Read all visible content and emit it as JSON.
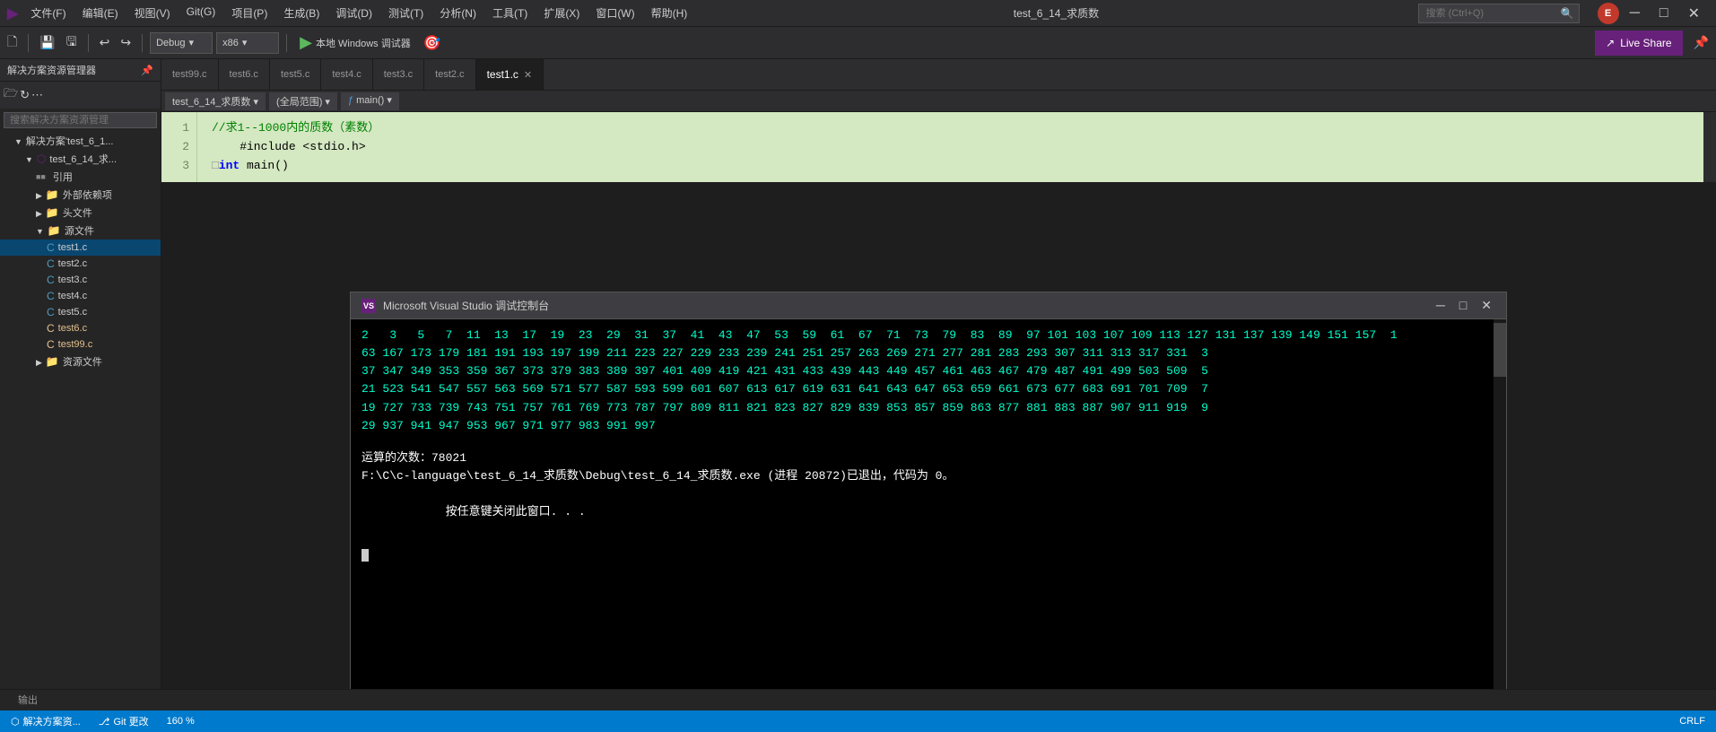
{
  "app": {
    "title": "test_6_14_求质数",
    "icon": "▶"
  },
  "menu": {
    "items": [
      "文件(F)",
      "编辑(E)",
      "视图(V)",
      "Git(G)",
      "项目(P)",
      "生成(B)",
      "调试(D)",
      "测试(T)",
      "分析(N)",
      "工具(T)",
      "扩展(X)",
      "窗口(W)",
      "帮助(H)"
    ]
  },
  "search": {
    "placeholder": "搜索 (Ctrl+Q)"
  },
  "toolbar": {
    "config_label": "Debug",
    "platform_label": "x86",
    "run_label": "本地 Windows 调试器",
    "liveshare_label": "Live Share"
  },
  "sidebar": {
    "header": "解决方案资源管理器",
    "search_placeholder": "搜索解决方案资源管理",
    "tree": [
      {
        "label": "解决方案'test_6_1...",
        "level": 1,
        "type": "solution",
        "expanded": true
      },
      {
        "label": "test_6_14_求...",
        "level": 2,
        "type": "project",
        "expanded": true
      },
      {
        "label": "引用",
        "level": 3,
        "type": "folder",
        "expanded": false
      },
      {
        "label": "外部依赖项",
        "level": 3,
        "type": "folder",
        "expanded": false
      },
      {
        "label": "头文件",
        "level": 3,
        "type": "folder",
        "expanded": false
      },
      {
        "label": "源文件",
        "level": 3,
        "type": "folder",
        "expanded": true
      },
      {
        "label": "test1.c",
        "level": 4,
        "type": "file-active"
      },
      {
        "label": "test2.c",
        "level": 4,
        "type": "file"
      },
      {
        "label": "test3.c",
        "level": 4,
        "type": "file"
      },
      {
        "label": "test4.c",
        "level": 4,
        "type": "file"
      },
      {
        "label": "test5.c",
        "level": 4,
        "type": "file"
      },
      {
        "label": "test6.c",
        "level": 4,
        "type": "file-modified"
      },
      {
        "label": "test99.c",
        "level": 4,
        "type": "file-modified"
      },
      {
        "label": "资源文件",
        "level": 3,
        "type": "folder",
        "expanded": false
      }
    ]
  },
  "tabs": [
    {
      "label": "test99.c",
      "active": false,
      "modified": false
    },
    {
      "label": "test6.c",
      "active": false,
      "modified": false
    },
    {
      "label": "test5.c",
      "active": false,
      "modified": false
    },
    {
      "label": "test4.c",
      "active": false,
      "modified": false
    },
    {
      "label": "test3.c",
      "active": false,
      "modified": false
    },
    {
      "label": "test2.c",
      "active": false,
      "modified": false
    },
    {
      "label": "test1.c",
      "active": true,
      "modified": false
    }
  ],
  "navbar": {
    "breadcrumb": "test_6_14_求质数",
    "scope": "(全局范围)",
    "function": "main()"
  },
  "code": {
    "lines": [
      {
        "num": "1",
        "content": "    //求1--1000内的质数（素数）"
      },
      {
        "num": "2",
        "content": "    #include <stdio.h>"
      },
      {
        "num": "3",
        "content": "  □int main()"
      }
    ]
  },
  "debug_console": {
    "title": "Microsoft Visual Studio 调试控制台",
    "output_lines": [
      "2   3   5   7  11  13  17  19  23  29  31  37  41  43  47  53  59  61  67  71  73  79  83  89  97 101 103 107 109 113 127 131 137 139 149 151 157  1",
      "63 167 173 179 181 191 193 197 199 211 223 227 229 233 239 241 251 257 263 269 271 277 281 283 293 307 311 313 317 331  3",
      "37 347 349 353 359 367 373 379 383 389 397 401 409 419 421 431 433 439 443 449 457 461 463 467 479 487 491 499 503 509  5",
      "21 523 541 547 557 563 569 571 577 587 593 599 601 607 613 617 619 631 641 643 647 653 659 661 673 677 683 691 701 709  7",
      "19 727 733 739 743 751 757 761 769 773 787 797 809 811 821 823 827 829 839 853 857 859 863 877 881 883 887 907 911 919  9",
      "29 937 941 947 953 967 971 977 983 991 997"
    ],
    "stats_line": "运算的次数：78021",
    "exit_line": "F:\\C\\c-language\\test_6_14_求质数\\Debug\\test_6_14_求质数.exe (进程 20872)已退出，代码为 0。",
    "close_line": "按任意键关闭此窗口. . ."
  },
  "status_bar": {
    "git_branch": "Git 更改",
    "solution": "解决方案资...",
    "zoom": "160 %",
    "encoding": "CRLF"
  },
  "bottom_panel": {
    "tab": "输出"
  }
}
